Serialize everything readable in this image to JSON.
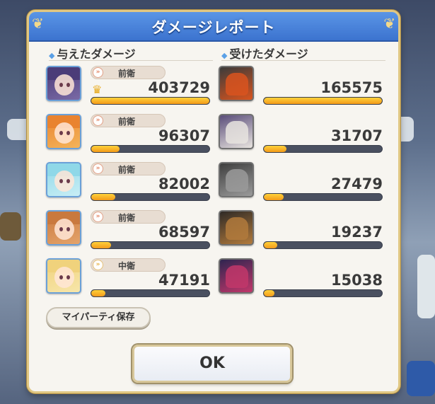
{
  "dialog": {
    "title": "ダメージレポート",
    "accent": "#3c73cf",
    "gold": "#e0c783"
  },
  "dealt": {
    "title": "与えたダメージ",
    "max": 403729,
    "rows": [
      {
        "position": "前衛",
        "damage": "403729",
        "value": 403729,
        "top": true,
        "icon": "front-line-icon",
        "colors": [
          "#4b3c78",
          "#7a6aa6"
        ]
      },
      {
        "position": "前衛",
        "damage": "96307",
        "value": 96307,
        "top": false,
        "icon": "front-line-icon",
        "colors": [
          "#e9832f",
          "#f4b45a"
        ]
      },
      {
        "position": "前衛",
        "damage": "82002",
        "value": 82002,
        "top": false,
        "icon": "front-line-icon",
        "colors": [
          "#8fd8e8",
          "#c8eef5"
        ]
      },
      {
        "position": "前衛",
        "damage": "68597",
        "value": 68597,
        "top": false,
        "icon": "front-line-icon",
        "colors": [
          "#c9793e",
          "#e4a36a"
        ]
      },
      {
        "position": "中衛",
        "damage": "47191",
        "value": 47191,
        "top": false,
        "icon": "middle-line-icon",
        "colors": [
          "#f0d27c",
          "#f7e6aa"
        ]
      }
    ]
  },
  "received": {
    "title": "受けたダメージ",
    "max": 165575,
    "rows": [
      {
        "damage": "165575",
        "value": 165575,
        "colors": [
          "#3b3b3b",
          "#d9541e"
        ]
      },
      {
        "damage": "31707",
        "value": 31707,
        "colors": [
          "#5a4d7a",
          "#e8e4df"
        ]
      },
      {
        "damage": "27479",
        "value": 27479,
        "colors": [
          "#3f3f3f",
          "#9a9a9a"
        ]
      },
      {
        "damage": "19237",
        "value": 19237,
        "colors": [
          "#2f2a26",
          "#b27a3c"
        ]
      },
      {
        "damage": "15038",
        "value": 15038,
        "colors": [
          "#2f2550",
          "#c2376a"
        ]
      }
    ]
  },
  "buttons": {
    "party_save": "マイパーティ保存",
    "ok": "OK"
  }
}
